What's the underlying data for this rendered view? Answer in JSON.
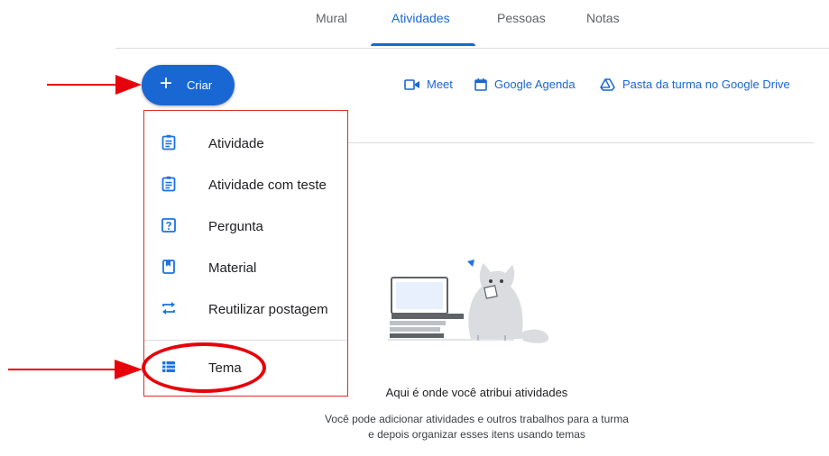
{
  "nav": {
    "tabs": [
      {
        "label": "Mural"
      },
      {
        "label": "Atividades",
        "active": true
      },
      {
        "label": "Pessoas"
      },
      {
        "label": "Notas"
      }
    ]
  },
  "create_button": {
    "label": "Criar",
    "icon": "plus-icon"
  },
  "links": [
    {
      "label": "Meet",
      "icon": "video-camera-icon"
    },
    {
      "label": "Google Agenda",
      "icon": "calendar-icon"
    },
    {
      "label": "Pasta da turma no Google Drive",
      "icon": "google-drive-icon"
    }
  ],
  "menu": {
    "items": [
      {
        "label": "Atividade",
        "icon": "assignment-icon"
      },
      {
        "label": "Atividade com teste",
        "icon": "assignment-quiz-icon"
      },
      {
        "label": "Pergunta",
        "icon": "question-icon"
      },
      {
        "label": "Material",
        "icon": "material-book-icon"
      },
      {
        "label": "Reutilizar postagem",
        "icon": "repeat-icon"
      },
      {
        "label": "Tema",
        "icon": "topic-list-icon"
      }
    ]
  },
  "empty_state": {
    "title": "Aqui é onde você atribui atividades",
    "description": "Você pode adicionar atividades e outros trabalhos para a turma e depois organizar esses itens usando temas"
  },
  "colors": {
    "accent": "#1967d2",
    "annotation_red": "#e8000b",
    "icon_blue": "#1a73e8"
  }
}
